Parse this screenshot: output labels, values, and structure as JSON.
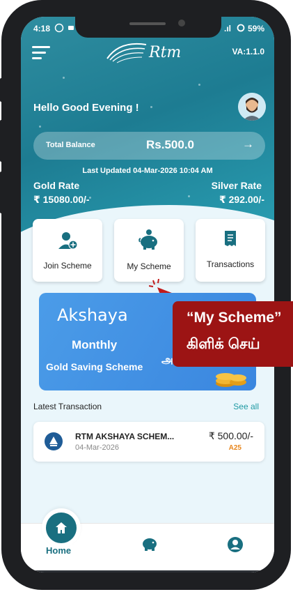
{
  "status_bar": {
    "time": "4:18",
    "signal": ".ıl",
    "battery": "59%"
  },
  "header": {
    "logo_text": "Rtm",
    "version": "VA:1.1.0",
    "greeting": "Hello Good Evening !"
  },
  "balance": {
    "label": "Total Balance",
    "value": "Rs.500.0",
    "arrow": "→"
  },
  "rates": {
    "last_updated": "Last Updated 04-Mar-2026 10:04 AM",
    "gold_label": "Gold Rate",
    "gold_value": "₹ 15080.00/-",
    "silver_label": "Silver Rate",
    "silver_value": "₹ 292.00/-"
  },
  "actions": [
    {
      "label": "Join Scheme",
      "icon": "add-user-icon"
    },
    {
      "label": "My Scheme",
      "icon": "piggy-bank-icon"
    },
    {
      "label": "Transactions",
      "icon": "receipt-icon"
    }
  ],
  "banner": {
    "title": "Akshaya",
    "sub1": "Monthly",
    "sub2": "Gold Saving Scheme",
    "tamil": "அக்ஷயா"
  },
  "callout": {
    "line1": "“My Scheme”",
    "line2": "கிளிக் செய்"
  },
  "latest": {
    "title": "Latest Transaction",
    "see_all": "See all"
  },
  "transaction": {
    "name": "RTM AKSHAYA SCHEM...",
    "date": "04-Mar-2026",
    "amount": "₹ 500.00/-",
    "code": "A25"
  },
  "bottom_nav": {
    "home_label": "Home"
  },
  "colors": {
    "header": "#1d7c92",
    "accent": "#196f80",
    "callout": "#9c1414",
    "banner": "#3a86df"
  }
}
